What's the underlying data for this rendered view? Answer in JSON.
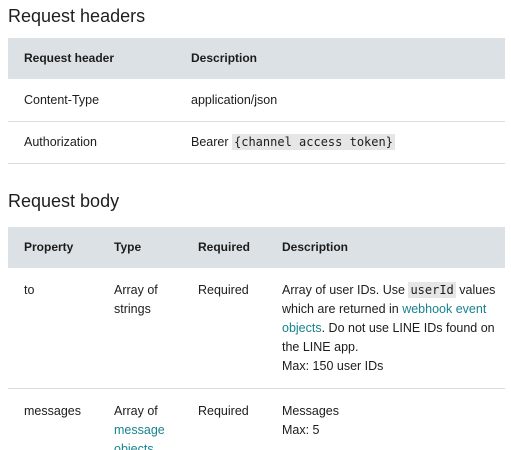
{
  "request_headers": {
    "title": "Request headers",
    "columns": [
      "Request header",
      "Description"
    ],
    "rows": [
      {
        "header": "Content-Type",
        "description": "application/json"
      },
      {
        "header": "Authorization",
        "desc_prefix": "Bearer ",
        "desc_code": "{channel access token}"
      }
    ]
  },
  "request_body": {
    "title": "Request body",
    "columns": [
      "Property",
      "Type",
      "Required",
      "Description"
    ],
    "rows": [
      {
        "property": "to",
        "type": "Array of strings",
        "required": "Required",
        "desc_1": "Array of user IDs. Use ",
        "desc_code": "userId",
        "desc_2": " values which are returned in ",
        "desc_link": "webhook event objects",
        "desc_3": ". Do not use LINE IDs found on the LINE app.",
        "desc_max": "Max: 150 user IDs"
      },
      {
        "property": "messages",
        "type_prefix": "Array of ",
        "type_link": "message objects",
        "required": "Required",
        "desc_1": "Messages",
        "desc_max": "Max: 5"
      }
    ]
  },
  "colors": {
    "link": "#16848f",
    "table_header_bg": "#dce1e5",
    "code_bg": "#e6e6e6"
  }
}
